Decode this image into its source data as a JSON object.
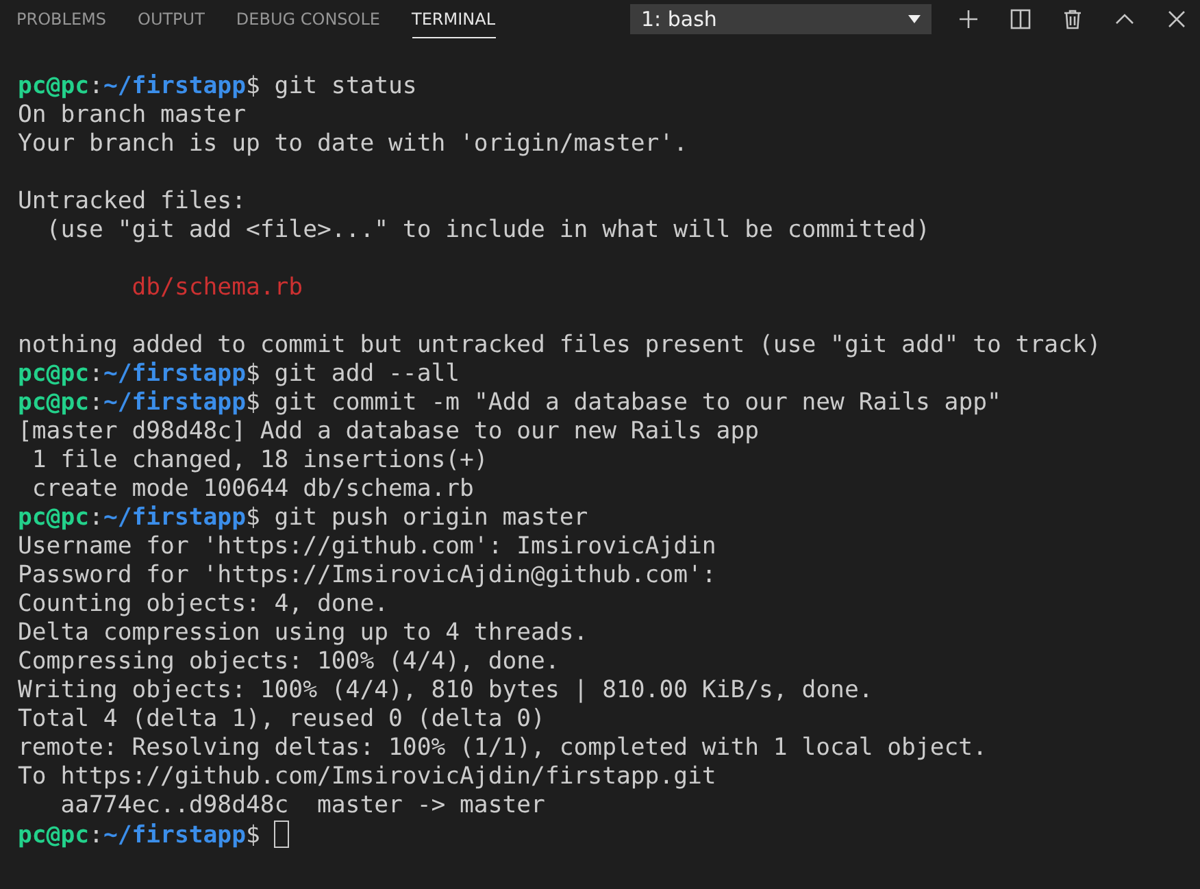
{
  "panel_tabs": [
    {
      "label": "PROBLEMS",
      "selected": false
    },
    {
      "label": "OUTPUT",
      "selected": false
    },
    {
      "label": "DEBUG CONSOLE",
      "selected": false
    },
    {
      "label": "TERMINAL",
      "selected": true
    }
  ],
  "terminal_select": {
    "value": "1: bash"
  },
  "terminal_lines": [
    {
      "kind": "prompt",
      "user": "pc@pc",
      "separator": ":",
      "path": "~/firstapp",
      "symbol": "$",
      "command": "git status",
      "cursor": false
    },
    {
      "kind": "output",
      "text": "On branch master"
    },
    {
      "kind": "output",
      "text": "Your branch is up to date with 'origin/master'."
    },
    {
      "kind": "blank"
    },
    {
      "kind": "output",
      "text": "Untracked files:"
    },
    {
      "kind": "output",
      "text": "  (use \"git add <file>...\" to include in what will be committed)"
    },
    {
      "kind": "blank"
    },
    {
      "kind": "untracked",
      "text": "        db/schema.rb"
    },
    {
      "kind": "blank"
    },
    {
      "kind": "output",
      "text": "nothing added to commit but untracked files present (use \"git add\" to track)"
    },
    {
      "kind": "prompt",
      "user": "pc@pc",
      "separator": ":",
      "path": "~/firstapp",
      "symbol": "$",
      "command": "git add --all",
      "cursor": false
    },
    {
      "kind": "prompt",
      "user": "pc@pc",
      "separator": ":",
      "path": "~/firstapp",
      "symbol": "$",
      "command": "git commit -m \"Add a database to our new Rails app\"",
      "cursor": false
    },
    {
      "kind": "output",
      "text": "[master d98d48c] Add a database to our new Rails app"
    },
    {
      "kind": "output",
      "text": " 1 file changed, 18 insertions(+)"
    },
    {
      "kind": "output",
      "text": " create mode 100644 db/schema.rb"
    },
    {
      "kind": "prompt",
      "user": "pc@pc",
      "separator": ":",
      "path": "~/firstapp",
      "symbol": "$",
      "command": "git push origin master",
      "cursor": false
    },
    {
      "kind": "output",
      "text": "Username for 'https://github.com': ImsirovicAjdin"
    },
    {
      "kind": "output",
      "text": "Password for 'https://ImsirovicAjdin@github.com':"
    },
    {
      "kind": "output",
      "text": "Counting objects: 4, done."
    },
    {
      "kind": "output",
      "text": "Delta compression using up to 4 threads."
    },
    {
      "kind": "output",
      "text": "Compressing objects: 100% (4/4), done."
    },
    {
      "kind": "output",
      "text": "Writing objects: 100% (4/4), 810 bytes | 810.00 KiB/s, done."
    },
    {
      "kind": "output",
      "text": "Total 4 (delta 1), reused 0 (delta 0)"
    },
    {
      "kind": "output",
      "text": "remote: Resolving deltas: 100% (1/1), completed with 1 local object."
    },
    {
      "kind": "output",
      "text": "To https://github.com/ImsirovicAjdin/firstapp.git"
    },
    {
      "kind": "output",
      "text": "   aa774ec..d98d48c  master -> master"
    },
    {
      "kind": "prompt",
      "user": "pc@pc",
      "separator": ":",
      "path": "~/firstapp",
      "symbol": "$",
      "cursor": true
    }
  ]
}
